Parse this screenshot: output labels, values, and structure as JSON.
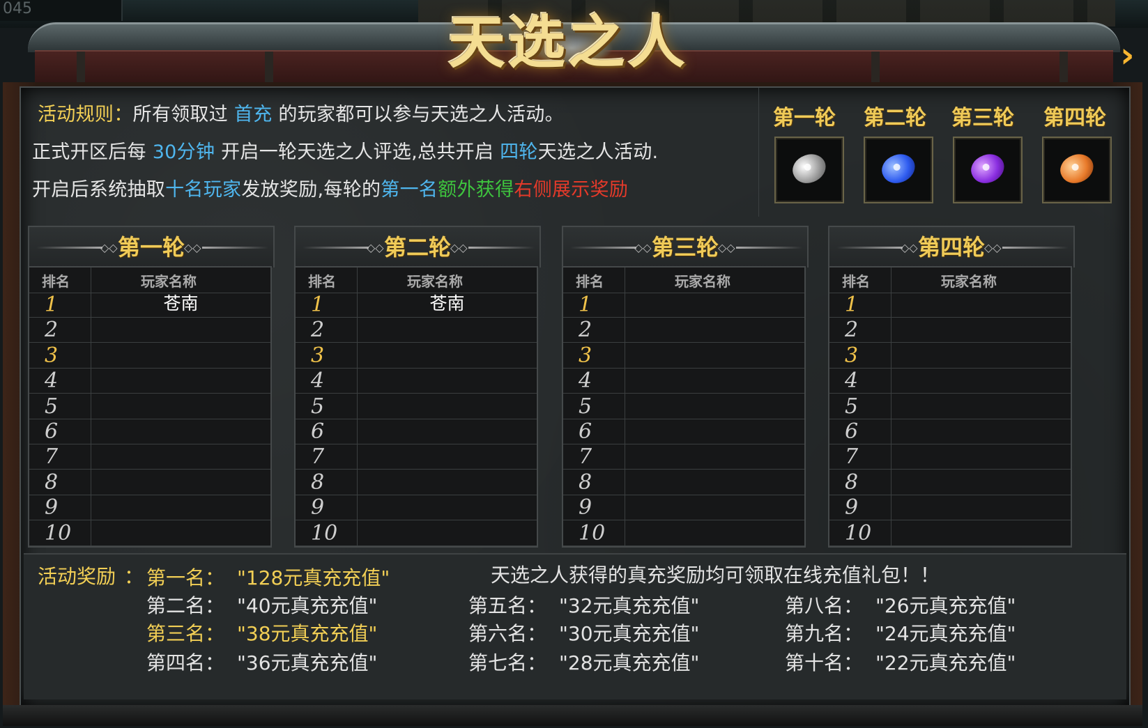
{
  "topbar": {
    "counter": "045"
  },
  "title": "天选之人",
  "rules": {
    "line1": {
      "label": "活动规则",
      "sep": "：",
      "a": "所有领取过 ",
      "b": "首充",
      "c": " 的玩家都可以参与天选之人活动。"
    },
    "line2": {
      "a": "正式开区后每 ",
      "b": "30分钟",
      "c": " 开启一轮天选之人评选,总共开启 ",
      "d": "四轮",
      "e": "天选之人活动."
    },
    "line3": {
      "a": "开启后系统抽取",
      "b": "十名玩家",
      "c": "发放奖励,每轮的",
      "d": "第一名",
      "e": "额外获得",
      "f": "右侧展示奖励"
    }
  },
  "round_rewards": [
    {
      "label": "第一轮",
      "icon": "silver-gem-icon",
      "color": "#d8d8d8"
    },
    {
      "label": "第二轮",
      "icon": "blue-gem-icon",
      "color": "#2f5cf0"
    },
    {
      "label": "第三轮",
      "icon": "purple-gem-icon",
      "color": "#8a2ee0"
    },
    {
      "label": "第四轮",
      "icon": "orange-gem-icon",
      "color": "#e87a2a"
    }
  ],
  "tables": {
    "col_rank": "排名",
    "col_name": "玩家名称",
    "rounds": [
      {
        "title": "第一轮",
        "rows": [
          {
            "rank": "1",
            "name": "苍南"
          },
          {
            "rank": "2",
            "name": ""
          },
          {
            "rank": "3",
            "name": ""
          },
          {
            "rank": "4",
            "name": ""
          },
          {
            "rank": "5",
            "name": ""
          },
          {
            "rank": "6",
            "name": ""
          },
          {
            "rank": "7",
            "name": ""
          },
          {
            "rank": "8",
            "name": ""
          },
          {
            "rank": "9",
            "name": ""
          },
          {
            "rank": "10",
            "name": ""
          }
        ]
      },
      {
        "title": "第二轮",
        "rows": [
          {
            "rank": "1",
            "name": "苍南"
          },
          {
            "rank": "2",
            "name": ""
          },
          {
            "rank": "3",
            "name": ""
          },
          {
            "rank": "4",
            "name": ""
          },
          {
            "rank": "5",
            "name": ""
          },
          {
            "rank": "6",
            "name": ""
          },
          {
            "rank": "7",
            "name": ""
          },
          {
            "rank": "8",
            "name": ""
          },
          {
            "rank": "9",
            "name": ""
          },
          {
            "rank": "10",
            "name": ""
          }
        ]
      },
      {
        "title": "第三轮",
        "rows": [
          {
            "rank": "1",
            "name": ""
          },
          {
            "rank": "2",
            "name": ""
          },
          {
            "rank": "3",
            "name": ""
          },
          {
            "rank": "4",
            "name": ""
          },
          {
            "rank": "5",
            "name": ""
          },
          {
            "rank": "6",
            "name": ""
          },
          {
            "rank": "7",
            "name": ""
          },
          {
            "rank": "8",
            "name": ""
          },
          {
            "rank": "9",
            "name": ""
          },
          {
            "rank": "10",
            "name": ""
          }
        ]
      },
      {
        "title": "第四轮",
        "rows": [
          {
            "rank": "1",
            "name": ""
          },
          {
            "rank": "2",
            "name": ""
          },
          {
            "rank": "3",
            "name": ""
          },
          {
            "rank": "4",
            "name": ""
          },
          {
            "rank": "5",
            "name": ""
          },
          {
            "rank": "6",
            "name": ""
          },
          {
            "rank": "7",
            "name": ""
          },
          {
            "rank": "8",
            "name": ""
          },
          {
            "rank": "9",
            "name": ""
          },
          {
            "rank": "10",
            "name": ""
          }
        ]
      }
    ]
  },
  "rewards": {
    "label": "活动奖励",
    "sep": "：",
    "notice": "天选之人获得的真充奖励均可领取在线充值礼包！！",
    "items": [
      {
        "place": "第一名：",
        "value": "\"128元真充充值\""
      },
      {
        "place": "第二名：",
        "value": "\"40元真充充值\""
      },
      {
        "place": "第三名：",
        "value": "\"38元真充充值\""
      },
      {
        "place": "第四名：",
        "value": "\"36元真充充值\""
      },
      {
        "place": "第五名：",
        "value": "\"32元真充充值\""
      },
      {
        "place": "第六名：",
        "value": "\"30元真充充值\""
      },
      {
        "place": "第七名：",
        "value": "\"28元真充充值\""
      },
      {
        "place": "第八名：",
        "value": "\"26元真充充值\""
      },
      {
        "place": "第九名：",
        "value": "\"24元真充充值\""
      },
      {
        "place": "第十名：",
        "value": "\"22元真充充值\""
      }
    ]
  }
}
